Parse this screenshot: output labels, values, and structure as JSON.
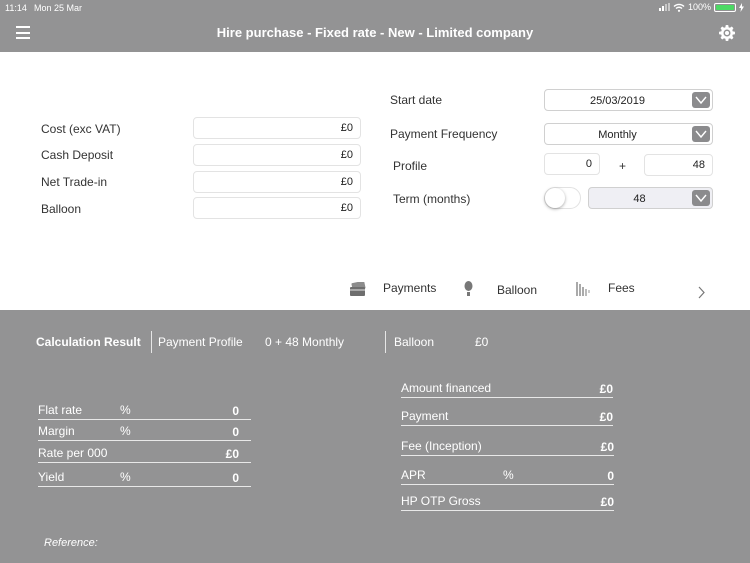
{
  "status_bar": {
    "time": "11:14",
    "date": "Mon 25 Mar",
    "battery": "100%",
    "battery_color": "#4cd964"
  },
  "header": {
    "title": "Hire purchase - Fixed rate - New - Limited company",
    "menu_icon": "hamburger-icon",
    "settings_icon": "gear-icon"
  },
  "form": {
    "left": [
      {
        "label": "Cost (exc VAT)",
        "value": "£0"
      },
      {
        "label": "Cash Deposit",
        "value": "£0"
      },
      {
        "label": "Net Trade-in",
        "value": "£0"
      },
      {
        "label": "Balloon",
        "value": "£0"
      }
    ],
    "start_date": {
      "label": "Start date",
      "value": "25/03/2019"
    },
    "payment_frequency": {
      "label": "Payment Frequency",
      "value": "Monthly"
    },
    "profile": {
      "label": "Profile",
      "upfront": "0",
      "plus": "+",
      "regular": "48"
    },
    "term": {
      "label": "Term (months)",
      "value": "48",
      "toggle_on": false
    }
  },
  "tabs": [
    {
      "label": "Payments",
      "icon": "card-icon"
    },
    {
      "label": "Balloon",
      "icon": "balloon-icon"
    },
    {
      "label": "Fees",
      "icon": "fees-icon"
    }
  ],
  "results": {
    "title": "Calculation Result",
    "payment_profile_label": "Payment Profile",
    "payment_profile_value": "0 + 48 Monthly",
    "balloon_label": "Balloon",
    "balloon_value": "£0",
    "left_rows": [
      {
        "label": "Flat rate",
        "unit": "%",
        "value": "0"
      },
      {
        "label": "Margin",
        "unit": "%",
        "value": "0"
      },
      {
        "label": "Rate per 000",
        "unit": "",
        "value": "£0"
      },
      {
        "label": "Yield",
        "unit": "%",
        "value": "0"
      }
    ],
    "right_rows": [
      {
        "label": "Amount financed",
        "unit": "",
        "value": "£0"
      },
      {
        "label": "Payment",
        "unit": "",
        "value": "£0"
      },
      {
        "label": "Fee (Inception)",
        "unit": "",
        "value": "£0"
      },
      {
        "label": "APR",
        "unit": "%",
        "value": "0"
      },
      {
        "label": "HP OTP Gross",
        "unit": "",
        "value": "£0"
      }
    ],
    "reference_label": "Reference:"
  }
}
